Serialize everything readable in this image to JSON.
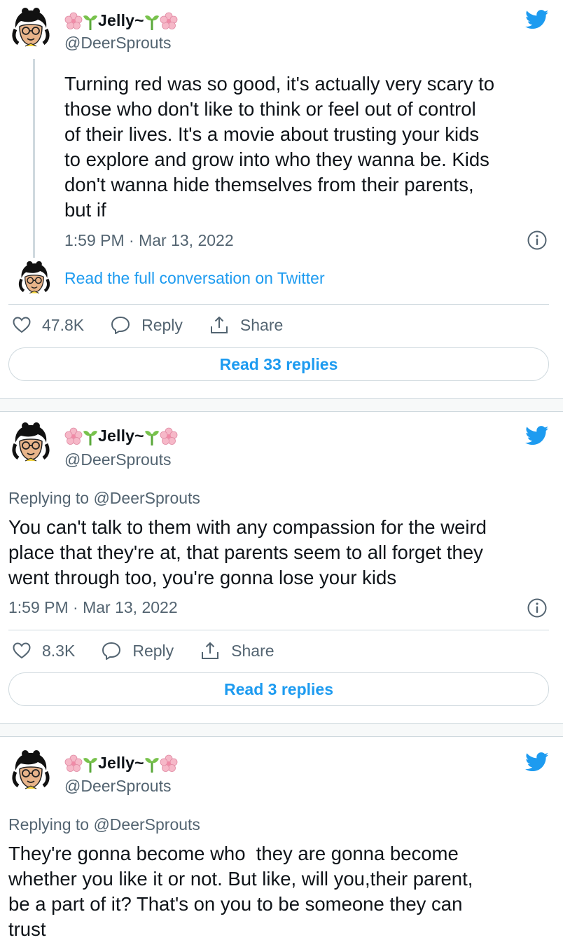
{
  "colors": {
    "accent": "#1d9bf0",
    "muted": "#536471",
    "text": "#0f1419",
    "border": "#cfd9de"
  },
  "tweets": [
    {
      "display_name": "Jelly~",
      "handle": "@DeerSprouts",
      "text_lines": [
        "Turning red was so good, it's actually very scary to",
        "those who don't like to think or feel out of control",
        "of their lives. It's a movie about trusting your kids",
        "to explore and grow into who they wanna be. Kids",
        "don't wanna hide themselves from their parents,",
        "but if"
      ],
      "timestamp": "1:59 PM · Mar 13, 2022",
      "read_conversation": "Read the full conversation on Twitter",
      "likes": "47.8K",
      "reply_label": "Reply",
      "share_label": "Share",
      "read_replies": "Read 33 replies"
    },
    {
      "display_name": "Jelly~",
      "handle": "@DeerSprouts",
      "replying_to": "Replying to @DeerSprouts",
      "text_lines": [
        "You can't talk to them with any compassion for the weird",
        "place that they're at, that parents seem to all forget they",
        "went through too, you're gonna lose your kids"
      ],
      "timestamp": "1:59 PM · Mar 13, 2022",
      "likes": "8.3K",
      "reply_label": "Reply",
      "share_label": "Share",
      "read_replies": "Read 3 replies"
    },
    {
      "display_name": "Jelly~",
      "handle": "@DeerSprouts",
      "replying_to": "Replying to @DeerSprouts",
      "text_lines": [
        "They're gonna become who  they are gonna become",
        "whether you like it or not. But like, will you,their parent,",
        "be a part of it? That's on you to be someone they can",
        "trust"
      ]
    }
  ],
  "icons": [
    "avatar",
    "flower-icon",
    "sprout-icon",
    "twitter-bird-icon",
    "info-icon",
    "heart-icon",
    "reply-bubble-icon",
    "share-icon"
  ]
}
